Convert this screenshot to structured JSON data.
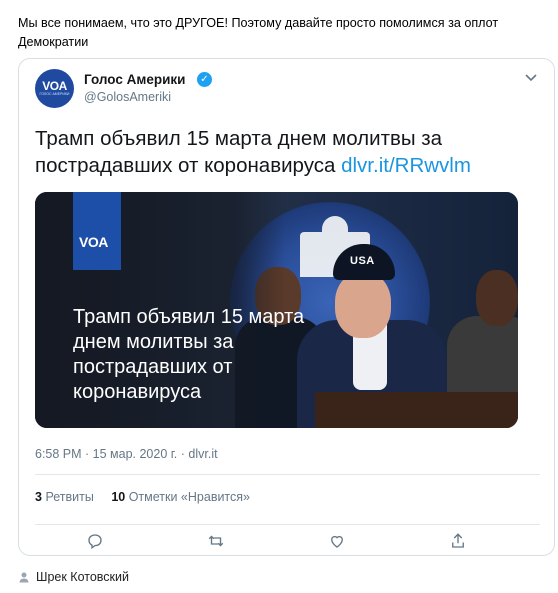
{
  "post": {
    "text": "Мы все понимаем, что это ДРУГОЕ! Поэтому давайте просто помолимся за оплот Демократии"
  },
  "tweet": {
    "avatar_logo": "VOA",
    "avatar_sub": "ГОЛОС АМЕРИКИ",
    "author_name": "Голос Америки",
    "author_handle": "@GolosAmeriki",
    "text": "Трамп объявил 15 марта днем молитвы за пострадавших от коронавируса ",
    "link": "dlvr.it/RRwvlm",
    "media": {
      "logo": "VOA",
      "cap_text": "USA",
      "caption": "Трамп объявил 15 марта днем молитвы за пострадавших от коронавируса"
    },
    "time": "6:58 PM · 15 мар. 2020 г. · ",
    "source": "dlvr.it",
    "retweets_count": "3",
    "retweets_label": "Ретвиты",
    "likes_count": "10",
    "likes_label": "Отметки «Нравится»"
  },
  "footer": {
    "author": "Шрек Котовский"
  },
  "colors": {
    "link": "#1b95e0",
    "avatar_bg": "#1f4aa0",
    "verified": "#1da1f2",
    "muted": "#657786"
  },
  "icons": [
    "verified-icon",
    "chevron-down-icon",
    "reply-icon",
    "retweet-icon",
    "like-icon",
    "share-icon",
    "user-icon"
  ]
}
